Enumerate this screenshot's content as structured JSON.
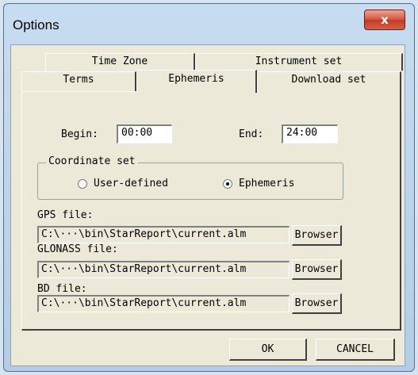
{
  "window": {
    "title": "Options",
    "close_glyph": "x"
  },
  "tabs": {
    "row_back": [
      "Time Zone",
      "Instrument set"
    ],
    "row_front": [
      "Terms",
      "Ephemeris",
      "Download set"
    ],
    "active": "Ephemeris"
  },
  "time": {
    "begin_label": "Begin:",
    "begin_value": "00:00",
    "end_label": "End:",
    "end_value": "24:00"
  },
  "coordinate_set": {
    "title": "Coordinate set",
    "options": [
      "User-defined",
      "Ephemeris"
    ],
    "selected": "Ephemeris"
  },
  "files": [
    {
      "label": "GPS file:",
      "path": "C:\\···\\bin\\StarReport\\current.alm",
      "button": "Browser"
    },
    {
      "label": "GLONASS file:",
      "path": "C:\\···\\bin\\StarReport\\current.alm",
      "button": "Browser"
    },
    {
      "label": "BD file:",
      "path": "C:\\···\\bin\\StarReport\\current.alm",
      "button": "Browser"
    }
  ],
  "footer": {
    "ok": "OK",
    "cancel": "CANCEL"
  }
}
